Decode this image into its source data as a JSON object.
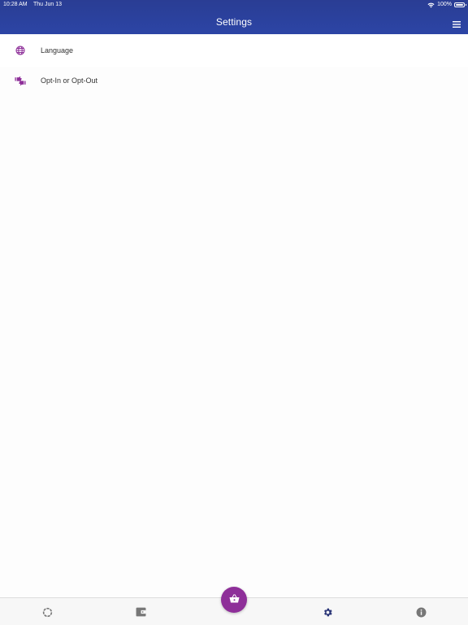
{
  "status_bar": {
    "time": "10:28 AM",
    "date": "Thu Jun 13",
    "battery": "100%"
  },
  "header": {
    "title": "Settings",
    "menu_icon": "hamburger-menu-icon"
  },
  "settings": {
    "items": [
      {
        "label": "Language",
        "icon": "globe-icon"
      },
      {
        "label": "Opt-In or Opt-Out",
        "icon": "thumbs-up-down-icon"
      }
    ]
  },
  "tabbar": {
    "tabs": [
      {
        "icon": "circle-progress-icon"
      },
      {
        "icon": "wallet-icon"
      },
      {
        "icon": "basket-icon",
        "center": true
      },
      {
        "icon": "gear-icon",
        "active": true
      },
      {
        "icon": "info-icon"
      }
    ]
  },
  "colors": {
    "header": "#2b42a0",
    "accent": "#8e2f99",
    "icon_gray": "#777777",
    "active_tab": "#2a3577"
  }
}
